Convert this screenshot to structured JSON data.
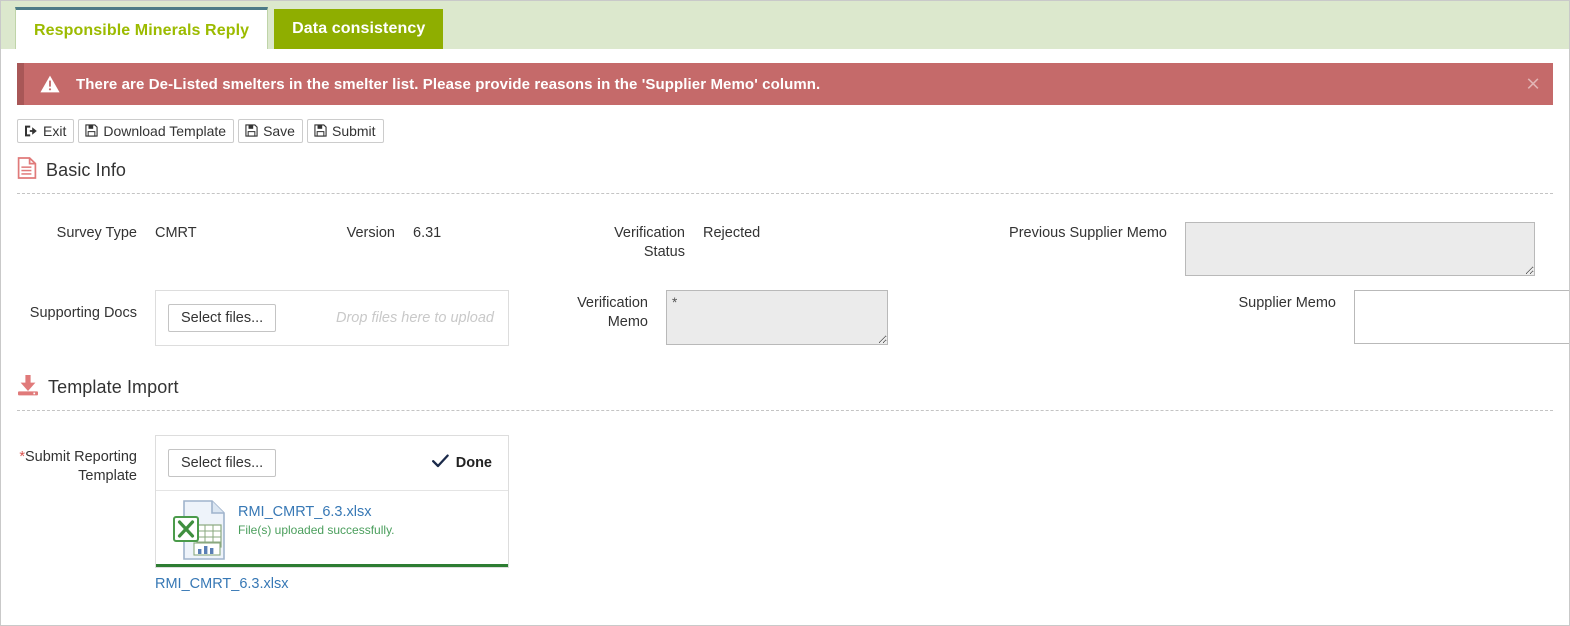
{
  "tabs": [
    {
      "label": "Responsible Minerals Reply",
      "state": "active"
    },
    {
      "label": "Data consistency",
      "state": "inactive"
    }
  ],
  "alert": {
    "icon": "warning-triangle-icon",
    "message": "There are De-Listed smelters in the smelter list. Please provide reasons in the 'Supplier Memo' column.",
    "close_label": "×",
    "background": "#c56a6a",
    "accent": "#a85757"
  },
  "toolbar": {
    "exit_label": "Exit",
    "download_template_label": "Download Template",
    "save_label": "Save",
    "submit_label": "Submit"
  },
  "basic_info": {
    "section_title": "Basic Info",
    "section_icon": "document-icon",
    "survey_type_label": "Survey Type",
    "survey_type_value": "CMRT",
    "version_label": "Version",
    "version_value": "6.31",
    "verification_status_label": "Verification Status",
    "verification_status_value": "Rejected",
    "previous_supplier_memo_label": "Previous Supplier Memo",
    "previous_supplier_memo_value": "",
    "supporting_docs_label": "Supporting Docs",
    "supporting_docs_select_label": "Select files...",
    "supporting_docs_drop_hint": "Drop files here to upload",
    "verification_memo_label": "Verification Memo",
    "verification_memo_value": "*",
    "supplier_memo_label": "Supplier Memo",
    "supplier_memo_value": ""
  },
  "template_import": {
    "section_title": "Template Import",
    "section_icon": "download-tray-icon",
    "submit_reporting_template_label": "Submit Reporting Template",
    "required_marker": "*",
    "select_label": "Select files...",
    "done_label": "Done",
    "done_icon": "check-icon",
    "file_icon": "excel-file-icon",
    "file_name": "RMI_CMRT_6.3.xlsx",
    "file_status": "File(s) uploaded successfully.",
    "below_file_link": "RMI_CMRT_6.3.xlsx",
    "progress_color": "#2d7d32"
  }
}
